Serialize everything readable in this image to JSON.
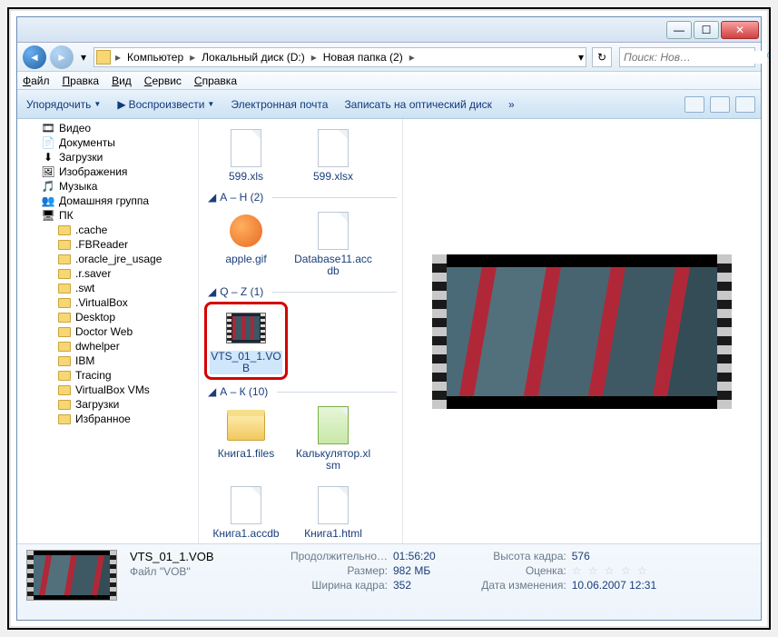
{
  "titlebar": {
    "min": "—",
    "max": "☐",
    "close": "✕"
  },
  "nav": {
    "breadcrumb": {
      "root_icon": "computer-icon",
      "items": [
        "Компьютер",
        "Локальный диск (D:)",
        "Новая папка (2)"
      ],
      "sep": "▸"
    },
    "search_placeholder": "Поиск: Нов…",
    "search_icon": "🔍"
  },
  "menu": [
    "Файл",
    "Правка",
    "Вид",
    "Сервис",
    "Справка"
  ],
  "toolbar": {
    "organize": "Упорядочить",
    "play": "Воспроизвести",
    "email": "Электронная почта",
    "burn": "Записать на оптический диск",
    "more": "»"
  },
  "sidebar": {
    "items": [
      {
        "icon": "video",
        "label": "Видео",
        "indent": false
      },
      {
        "icon": "doc",
        "label": "Документы",
        "indent": false
      },
      {
        "icon": "download",
        "label": "Загрузки",
        "indent": false
      },
      {
        "icon": "image",
        "label": "Изображения",
        "indent": false
      },
      {
        "icon": "music",
        "label": "Музыка",
        "indent": false
      },
      {
        "icon": "homegroup",
        "label": "Домашняя группа",
        "indent": false
      },
      {
        "icon": "pc",
        "label": "ПК",
        "indent": false
      },
      {
        "icon": "folder",
        "label": ".cache",
        "indent": true
      },
      {
        "icon": "folder",
        "label": ".FBReader",
        "indent": true
      },
      {
        "icon": "folder",
        "label": ".oracle_jre_usage",
        "indent": true
      },
      {
        "icon": "folder",
        "label": ".r.saver",
        "indent": true
      },
      {
        "icon": "folder",
        "label": ".swt",
        "indent": true
      },
      {
        "icon": "folder",
        "label": ".VirtualBox",
        "indent": true
      },
      {
        "icon": "folder",
        "label": "Desktop",
        "indent": true
      },
      {
        "icon": "folder",
        "label": "Doctor Web",
        "indent": true
      },
      {
        "icon": "folder",
        "label": "dwhelper",
        "indent": true
      },
      {
        "icon": "folder",
        "label": "IBM",
        "indent": true
      },
      {
        "icon": "folder",
        "label": "Tracing",
        "indent": true
      },
      {
        "icon": "folder",
        "label": "VirtualBox VMs",
        "indent": true
      },
      {
        "icon": "folder",
        "label": "Загрузки",
        "indent": true
      },
      {
        "icon": "folder",
        "label": "Избранное",
        "indent": true
      }
    ]
  },
  "groups": [
    {
      "header": "",
      "items": [
        {
          "type": "file",
          "label": "599.xls"
        },
        {
          "type": "file",
          "label": "599.xlsx"
        }
      ]
    },
    {
      "header": "А – Н (2)",
      "items": [
        {
          "type": "apple",
          "label": "apple.gif"
        },
        {
          "type": "file",
          "label": "Database11.accdb"
        }
      ]
    },
    {
      "header": "Q – Z (1)",
      "items": [
        {
          "type": "vob",
          "label": "VTS_01_1.VOB",
          "selected": true
        }
      ]
    },
    {
      "header": "А – К (10)",
      "items": [
        {
          "type": "folder",
          "label": "Книга1.files"
        },
        {
          "type": "excel",
          "label": "Калькулятор.xlsm"
        },
        {
          "type": "file",
          "label": "Книга1.accdb"
        },
        {
          "type": "file",
          "label": "Книга1.html"
        }
      ]
    }
  ],
  "details": {
    "title": "VTS_01_1.VOB",
    "subtitle": "Файл \"VOB\"",
    "rows": {
      "duration_k": "Продолжительно…",
      "duration_v": "01:56:20",
      "size_k": "Размер:",
      "size_v": "982 МБ",
      "width_k": "Ширина кадра:",
      "width_v": "352",
      "height_k": "Высота кадра:",
      "height_v": "576",
      "rating_k": "Оценка:",
      "rating_v": "☆ ☆ ☆ ☆ ☆",
      "date_k": "Дата изменения:",
      "date_v": "10.06.2007 12:31"
    }
  }
}
